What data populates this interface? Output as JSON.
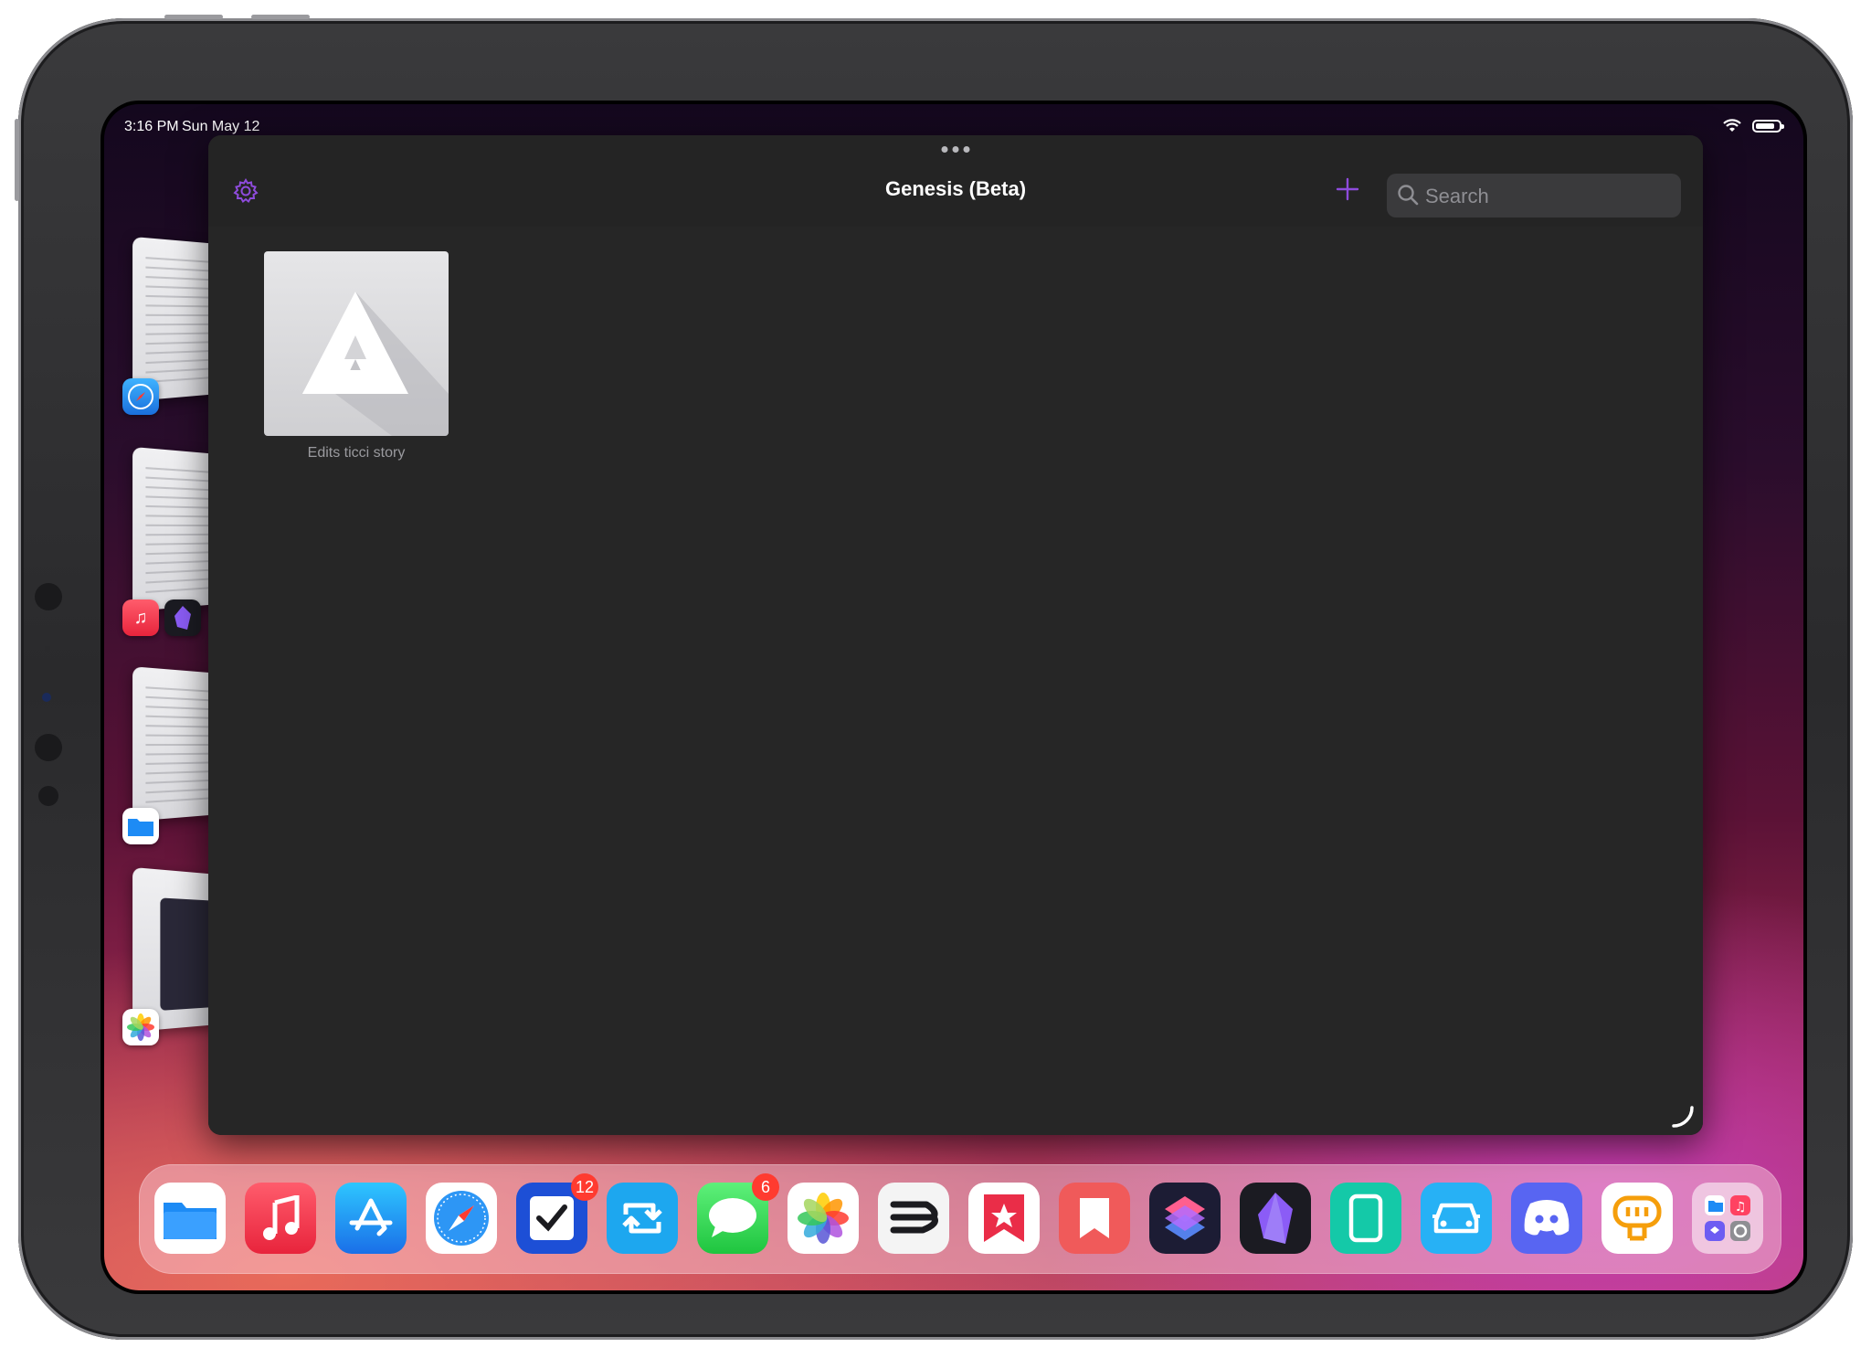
{
  "status_bar": {
    "time": "3:16 PM",
    "date": "Sun May 12"
  },
  "window": {
    "title": "Genesis (Beta)",
    "search_placeholder": "Search",
    "accent_color": "#8e4bdc",
    "documents": [
      {
        "label": "Edits ticci story"
      }
    ]
  },
  "stage_manager": {
    "groups": [
      {
        "apps": [
          "safari-icon"
        ]
      },
      {
        "apps": [
          "music-icon",
          "obsidian-icon"
        ]
      },
      {
        "apps": [
          "files-icon"
        ]
      },
      {
        "apps": [
          "photos-icon"
        ]
      }
    ]
  },
  "dock": {
    "apps": [
      {
        "name": "files-icon",
        "badge": ""
      },
      {
        "name": "music-icon",
        "badge": ""
      },
      {
        "name": "app-store-icon",
        "badge": ""
      },
      {
        "name": "safari-icon",
        "badge": ""
      },
      {
        "name": "tasks-icon",
        "badge": "12"
      },
      {
        "name": "retweet-icon",
        "badge": ""
      },
      {
        "name": "messages-icon",
        "badge": "6"
      },
      {
        "name": "photos-icon",
        "badge": ""
      },
      {
        "name": "drafts-icon",
        "badge": ""
      },
      {
        "name": "goodlinks-icon",
        "badge": ""
      },
      {
        "name": "bookmark-icon",
        "badge": ""
      },
      {
        "name": "shortcuts-icon",
        "badge": ""
      },
      {
        "name": "obsidian-icon",
        "badge": ""
      },
      {
        "name": "sidecar-icon",
        "badge": ""
      },
      {
        "name": "carplay-icon",
        "badge": ""
      },
      {
        "name": "discord-icon",
        "badge": ""
      },
      {
        "name": "chat-icon",
        "badge": ""
      },
      {
        "name": "app-library-icon",
        "badge": ""
      }
    ]
  }
}
